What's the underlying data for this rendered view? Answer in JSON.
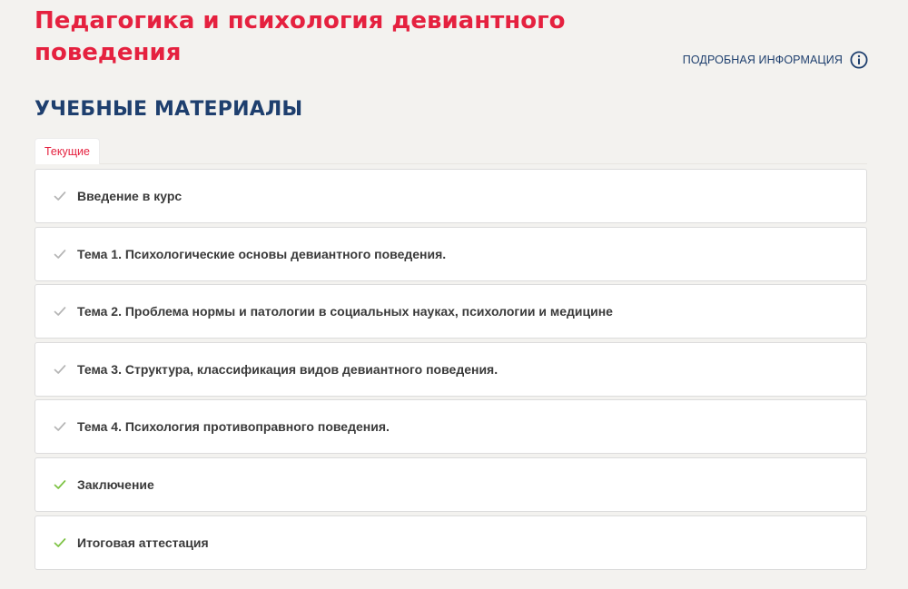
{
  "course": {
    "title": "Педагогика и психология девиантного поведения"
  },
  "info_link": {
    "label": "ПОДРОБНАЯ ИНФОРМАЦИЯ",
    "icon": "info-circle-icon"
  },
  "materials": {
    "heading": "УЧЕБНЫЕ МАТЕРИАЛЫ",
    "tabs": [
      {
        "label": "Текущие",
        "active": true
      }
    ],
    "items": [
      {
        "label": "Введение в курс",
        "status": "pending"
      },
      {
        "label": "Тема 1. Психологические основы девиантного поведения.",
        "status": "pending"
      },
      {
        "label": "Тема 2. Проблема нормы и патологии в социальных науках, психологии и медицине",
        "status": "pending"
      },
      {
        "label": "Тема 3. Структура, классификация видов девиантного поведения.",
        "status": "pending"
      },
      {
        "label": "Тема 4. Психология противоправного поведения.",
        "status": "pending"
      },
      {
        "label": "Заключение",
        "status": "done"
      },
      {
        "label": "Итоговая аттестация",
        "status": "done"
      }
    ]
  },
  "colors": {
    "brand_red": "#e5213f",
    "navy": "#1e3f6e",
    "check_pending": "#b5b5b5",
    "check_done": "#7cc242",
    "background": "#f3f2ef"
  }
}
